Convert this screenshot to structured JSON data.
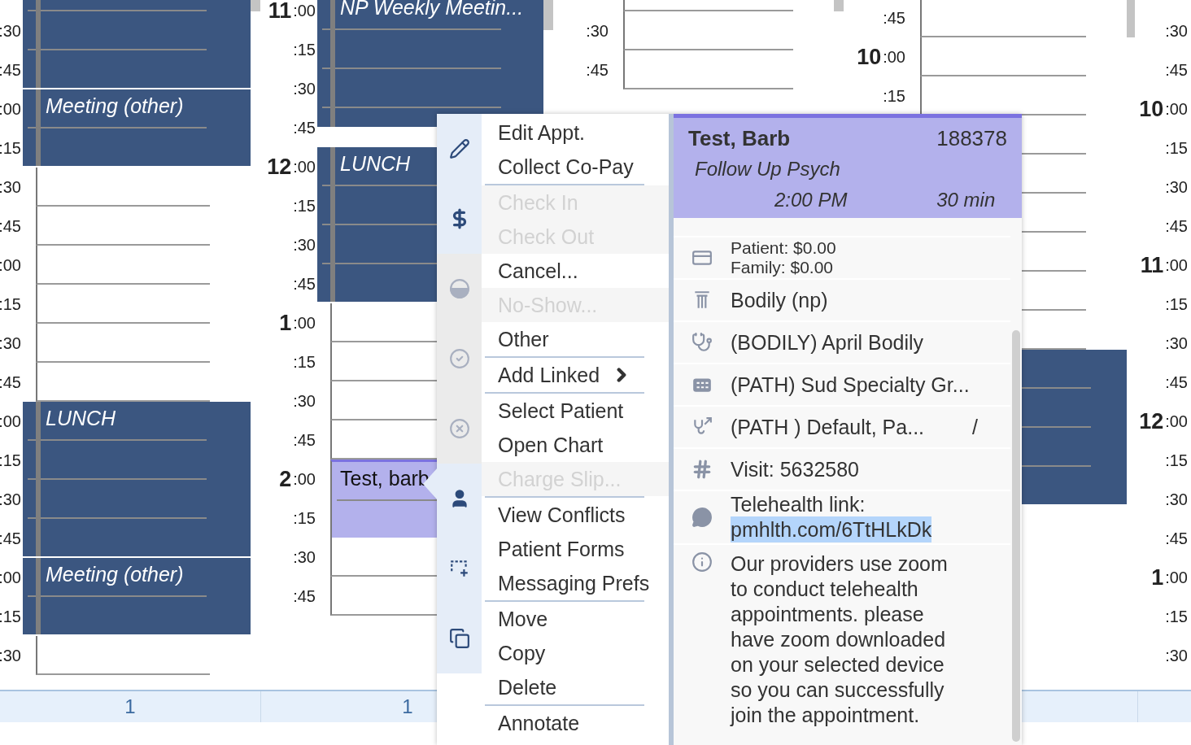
{
  "calendar": {
    "columns": [
      {
        "blocks": [
          {
            "kind": "blocked",
            "slots": [
              {
                "covered": true
              },
              {
                "minute": ":30"
              },
              {
                "minute": ":45"
              }
            ]
          },
          {
            "kind": "blocked",
            "title": "Meeting (other)",
            "slots": [
              {
                "minute": ":00"
              },
              {
                "minute": ":15"
              }
            ]
          },
          {
            "kind": "open",
            "slots": [
              {
                "minute": ":30"
              },
              {
                "minute": ":45"
              },
              {
                "minute": ":00"
              },
              {
                "minute": ":15"
              },
              {
                "minute": ":30"
              },
              {
                "minute": ":45"
              }
            ]
          },
          {
            "kind": "blocked",
            "title": "LUNCH",
            "slots": [
              {
                "minute": ":00"
              },
              {
                "minute": ":15"
              },
              {
                "minute": ":30"
              },
              {
                "minute": ":45"
              }
            ]
          },
          {
            "kind": "blocked",
            "title": "Meeting (other)",
            "slots": [
              {
                "minute": ":00"
              },
              {
                "minute": ":15"
              }
            ]
          },
          {
            "kind": "open",
            "slots": [
              {
                "minute": ":30"
              }
            ]
          }
        ]
      },
      {
        "blocks": [
          {
            "kind": "blocked",
            "title": "NP Weekly Meetin...",
            "slots": [
              {
                "hour": "11",
                "minute": ":00"
              },
              {
                "minute": ":15"
              },
              {
                "minute": ":30"
              },
              {
                "minute": ":45"
              }
            ]
          },
          {
            "kind": "blocked",
            "title": "LUNCH",
            "slots": [
              {
                "hour": "12",
                "minute": ":00"
              },
              {
                "minute": ":15"
              },
              {
                "minute": ":30"
              },
              {
                "minute": ":45"
              }
            ]
          },
          {
            "kind": "open",
            "slots": [
              {
                "hour": "1",
                "minute": ":00"
              },
              {
                "minute": ":15"
              },
              {
                "minute": ":30"
              },
              {
                "minute": ":45"
              }
            ]
          },
          {
            "kind": "patient",
            "title": "Test, barb",
            "slots": [
              {
                "hour": "2",
                "minute": ":00"
              },
              {
                "minute": ":15"
              }
            ]
          },
          {
            "kind": "open",
            "slots": [
              {
                "minute": ":30"
              },
              {
                "minute": ":45"
              }
            ]
          }
        ]
      },
      {
        "blocks": [
          {
            "kind": "open",
            "slots": [
              {
                "covered": true
              },
              {
                "minute": ":30"
              },
              {
                "minute": ":45"
              }
            ]
          }
        ]
      },
      {
        "blocks": [
          {
            "kind": "open",
            "slots": [
              {
                "minute": ":45"
              },
              {
                "hour": "10",
                "minute": ":00"
              },
              {
                "minute": ":15"
              },
              {
                "covered": true
              },
              {
                "covered": true
              },
              {
                "covered": true
              },
              {
                "covered": true
              },
              {
                "covered": true
              },
              {
                "covered": true
              }
            ]
          },
          {
            "kind": "blocked",
            "slots": [
              {
                "covered": true
              },
              {
                "covered": true
              },
              {
                "covered": true
              },
              {
                "covered": true
              }
            ]
          }
        ]
      },
      {
        "blocks": [
          {
            "kind": "open",
            "slots": [
              {
                "minute": ":30"
              },
              {
                "minute": ":45"
              },
              {
                "hour": "10",
                "minute": ":00"
              },
              {
                "minute": ":15"
              },
              {
                "minute": ":30"
              },
              {
                "minute": ":45"
              },
              {
                "hour": "11",
                "minute": ":00"
              },
              {
                "minute": ":15"
              },
              {
                "minute": ":30"
              },
              {
                "minute": ":45"
              },
              {
                "hour": "12",
                "minute": ":00"
              },
              {
                "minute": ":15"
              },
              {
                "minute": ":30"
              },
              {
                "minute": ":45"
              },
              {
                "hour": "1",
                "minute": ":00"
              },
              {
                "minute": ":15"
              },
              {
                "minute": ":30"
              }
            ]
          }
        ]
      }
    ],
    "footer": [
      {
        "count": "1"
      },
      {
        "count": "1"
      }
    ]
  },
  "context_menu": {
    "tool_icons": [
      {
        "kind": "edit",
        "disabled": false
      },
      {
        "kind": "payment",
        "disabled": false
      },
      {
        "kind": "cancel",
        "disabled": true
      },
      {
        "kind": "check",
        "disabled": true
      },
      {
        "kind": "noshow",
        "disabled": true
      },
      {
        "kind": "patient",
        "disabled": false
      },
      {
        "kind": "move",
        "disabled": false
      },
      {
        "kind": "copy",
        "disabled": false
      }
    ],
    "groups": [
      {
        "items": [
          {
            "label": "Edit Appt.",
            "disabled": false
          },
          {
            "label": "Collect Co-Pay",
            "disabled": false
          }
        ]
      },
      {
        "items": [
          {
            "label": "Check In",
            "disabled": true
          },
          {
            "label": "Check Out",
            "disabled": true
          },
          {
            "label": "Cancel...",
            "disabled": false
          },
          {
            "label": "No-Show...",
            "disabled": true
          },
          {
            "label": "Other",
            "disabled": false
          }
        ]
      },
      {
        "items": [
          {
            "label": "Add Linked",
            "disabled": false,
            "submenu": true
          }
        ]
      },
      {
        "items": [
          {
            "label": "Select Patient",
            "disabled": false
          },
          {
            "label": "Open Chart",
            "disabled": false
          },
          {
            "label": "Charge Slip...",
            "disabled": true
          }
        ]
      },
      {
        "items": [
          {
            "label": "View Conflicts",
            "disabled": false
          },
          {
            "label": "Patient Forms",
            "disabled": false
          },
          {
            "label": "Messaging Prefs",
            "disabled": false
          }
        ]
      },
      {
        "items": [
          {
            "label": "Move",
            "disabled": false
          },
          {
            "label": "Copy",
            "disabled": false
          },
          {
            "label": "Delete",
            "disabled": false
          }
        ]
      },
      {
        "items": [
          {
            "label": "Annotate",
            "disabled": false
          }
        ]
      }
    ]
  },
  "details": {
    "name": "Test, Barb",
    "patient_id": "188378",
    "type": "Follow Up Psych",
    "time": "2:00 PM",
    "duration": "30 min",
    "rows": [
      {
        "kind": "balance",
        "lines": [
          "Patient: $0.00",
          "Family: $0.00"
        ]
      },
      {
        "kind": "practice",
        "lines": [
          "Bodily (np)"
        ]
      },
      {
        "kind": "provider",
        "lines": [
          "(BODILY) April Bodily"
        ]
      },
      {
        "kind": "location",
        "lines": [
          "(PATH) Sud Specialty Gr..."
        ]
      },
      {
        "kind": "referral",
        "lines": [
          "(PATH ) Default, Pa..."
        ],
        "aside": "/"
      },
      {
        "kind": "visit",
        "lines": [
          "Visit: 5632580"
        ]
      },
      {
        "kind": "message",
        "lines": [
          "Telehealth link:"
        ],
        "link": {
          "text": "pmhlth.com/6TtHLkDk",
          "highlighted": true
        }
      },
      {
        "kind": "note",
        "lines": [
          "Our providers use zoom to conduct telehealth appointments. please have zoom downloaded on your selected device so you can successfully join the appointment."
        ]
      }
    ]
  }
}
